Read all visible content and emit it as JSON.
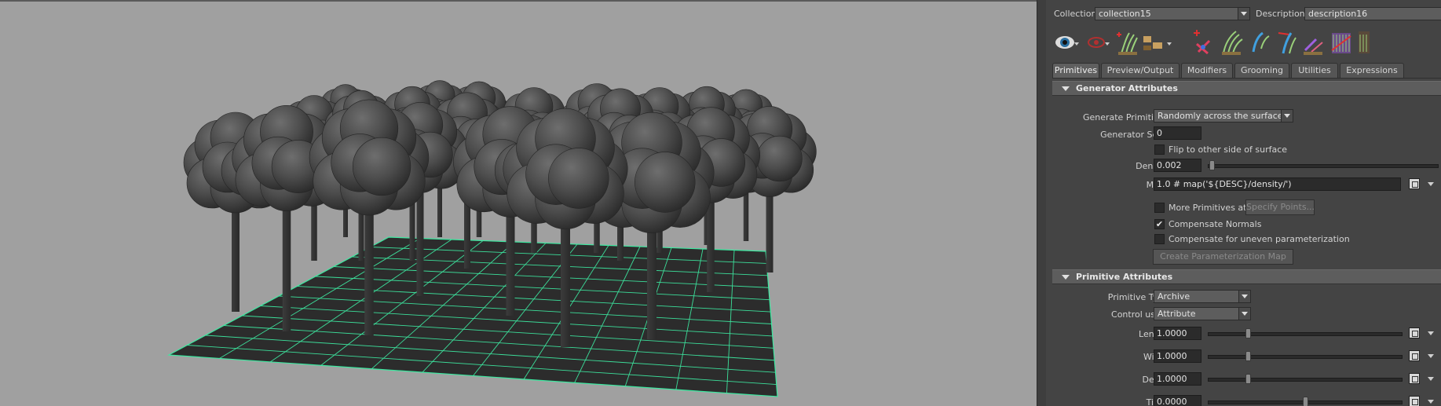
{
  "header": {
    "collection_label": "Collection",
    "collection_value": "collection15",
    "description_label": "Description",
    "description_value": "description16"
  },
  "toolbar": {
    "icons": [
      "eye-icon",
      "red-eye-icon",
      "add-guide-icon",
      "comb-icon",
      "paint-brush-icon",
      "add-guide-red-icon",
      "comb-green-icon",
      "move-guide-icon",
      "rotate-guide-icon",
      "length-guide-icon",
      "scale-icon",
      "noise-icon"
    ]
  },
  "tabs": [
    "Primitives",
    "Preview/Output",
    "Modifiers",
    "Grooming",
    "Utilities",
    "Expressions"
  ],
  "generator": {
    "title": "Generator Attributes",
    "generate_label": "Generate Primitives",
    "generate_value": "Randomly across the surface",
    "seed_label": "Generator Seed",
    "seed_value": "0",
    "flip_label": "Flip to other side of surface",
    "density_label": "Density",
    "density_value": "0.002",
    "density_level": 0.002,
    "mask_label": "Mask",
    "mask_value": "1.0 # map('${DESC}/density/')",
    "more_label": "More Primitives at",
    "specify_button": "Specify Points...",
    "compensate_normals_label": "Compensate Normals",
    "compensate_normals_checked": true,
    "compensate_uneven_label": "Compensate for uneven parameterization",
    "create_param_button": "Create Parameterization Map"
  },
  "primitive": {
    "title": "Primitive Attributes",
    "type_label": "Primitive Type",
    "type_value": "Archive",
    "control_label": "Control using",
    "control_value": "Attribute",
    "length_label": "Length",
    "length_value": "1.0000",
    "width_label": "Width",
    "width_value": "1.0000",
    "depth_label": "Depth",
    "depth_value": "1.0000",
    "tilt_label": "Tilt U",
    "tilt_value": "0.0000"
  },
  "colors": {
    "viewport_bg": "#a0a0a0",
    "grid_line": "#3de8a0",
    "panel_bg": "#444444"
  }
}
